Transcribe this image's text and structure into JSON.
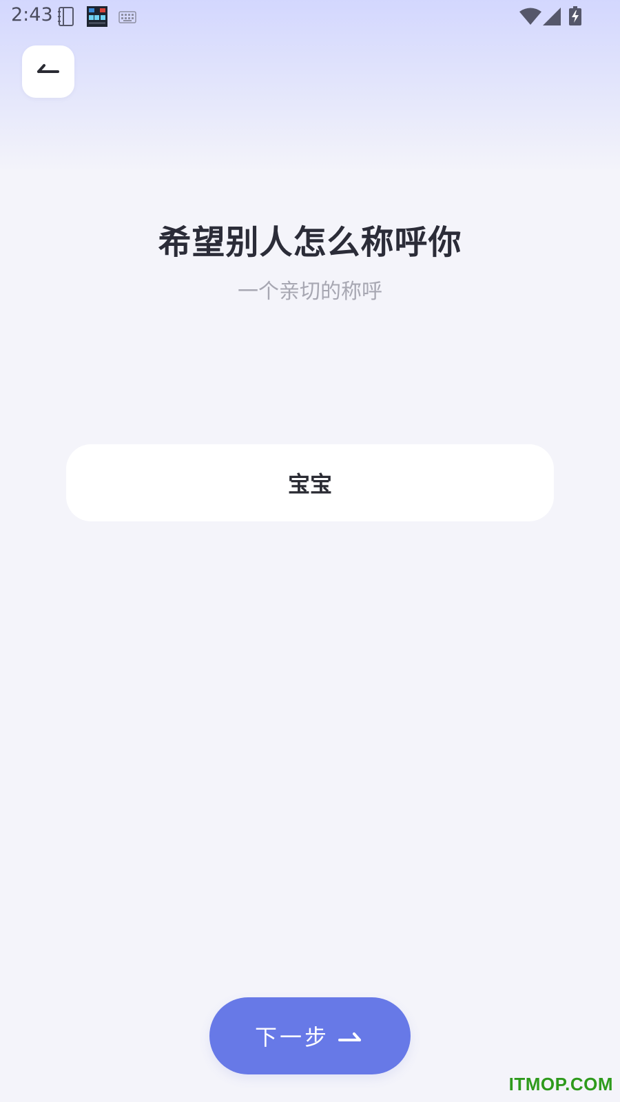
{
  "status_bar": {
    "time": "2:43",
    "icons": [
      "notebook-icon",
      "app-clock-icon",
      "keyboard-icon",
      "wifi-icon",
      "cell-signal-icon",
      "battery-charging-icon"
    ]
  },
  "header": {
    "back_icon": "back-arrow-icon"
  },
  "main": {
    "title": "希望别人怎么称呼你",
    "subtitle": "一个亲切的称呼",
    "nickname_value": "宝宝"
  },
  "footer": {
    "next_label": "下一步",
    "next_icon": "arrow-right-icon"
  },
  "watermark": "ITMOP.COM",
  "colors": {
    "accent": "#6779e7",
    "title": "#2b2c38",
    "subtitle": "#a7a7b2",
    "background": "#f4f4fa",
    "header_gradient": "#d3d7fe",
    "watermark": "#2e9a1c"
  }
}
